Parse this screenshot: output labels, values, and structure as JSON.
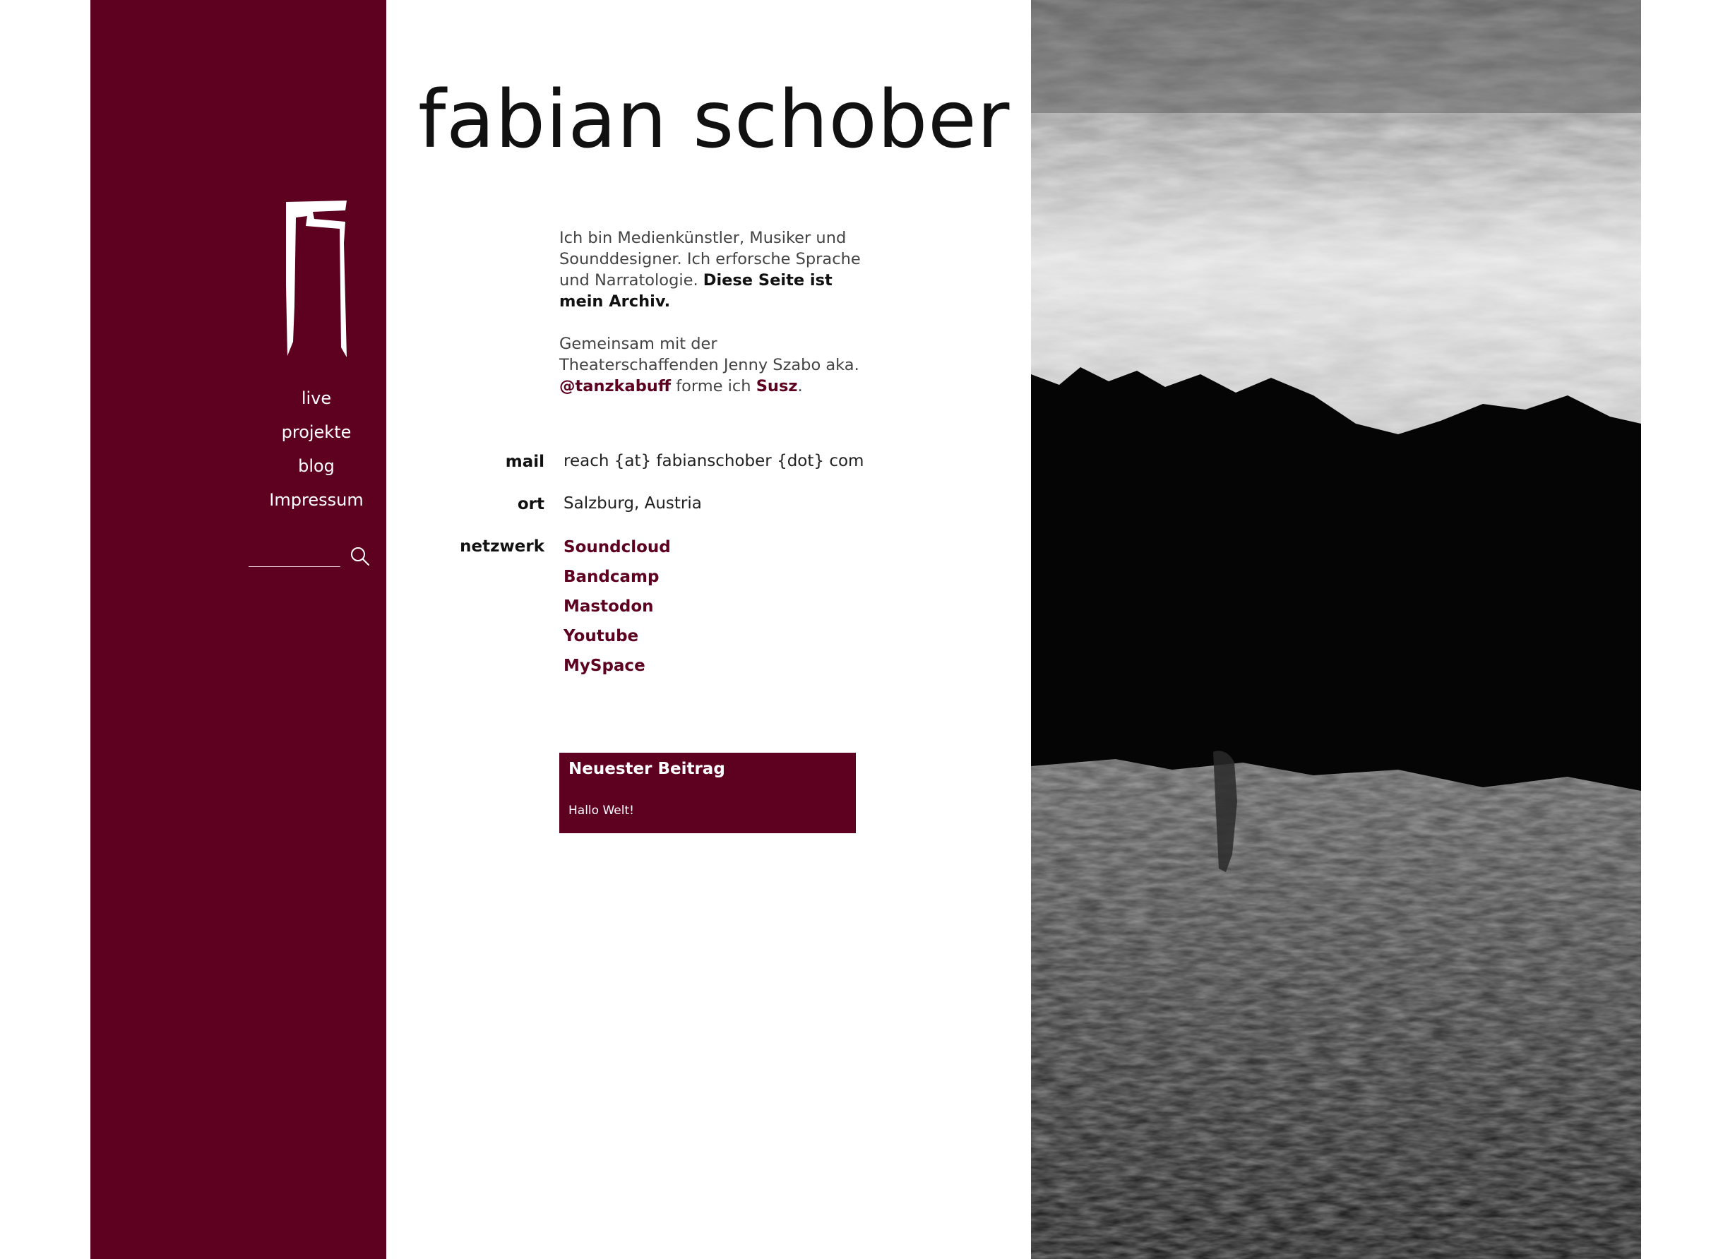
{
  "site": {
    "title": "fabian schober"
  },
  "brand": {
    "accent": "#5e0020",
    "logo_icon": "torn-frame-logo-icon"
  },
  "nav": {
    "items": [
      {
        "label": "live"
      },
      {
        "label": "projekte"
      },
      {
        "label": "blog"
      },
      {
        "label": "Impressum"
      }
    ]
  },
  "search": {
    "placeholder": "",
    "icon": "search-icon"
  },
  "intro": {
    "p1_text": "Ich bin Medienkünstler, Musiker und Sounddesigner. Ich erforsche Sprache und Narratologie. ",
    "p1_bold": "Diese Seite ist mein Archiv.",
    "p2_text_a": "Gemeinsam mit der Theaterschaffenden Jenny Szabo aka. ",
    "p2_link_1": "@tanzkabuff",
    "p2_text_b": " forme ich ",
    "p2_link_2": "Susz",
    "p2_text_c": "."
  },
  "contact": {
    "mail_label": "mail",
    "mail_value": "reach {at} fabianschober {dot} com",
    "ort_label": "ort",
    "ort_value": "Salzburg, Austria",
    "netzwerk_label": "netzwerk",
    "links": [
      {
        "label": "Soundcloud"
      },
      {
        "label": "Bandcamp"
      },
      {
        "label": "Mastodon"
      },
      {
        "label": "Youtube"
      },
      {
        "label": "MySpace"
      }
    ]
  },
  "latest": {
    "heading": "Neuester Beitrag",
    "post": "Hallo Welt!"
  },
  "hero_image": {
    "description": "black and white landscape"
  }
}
